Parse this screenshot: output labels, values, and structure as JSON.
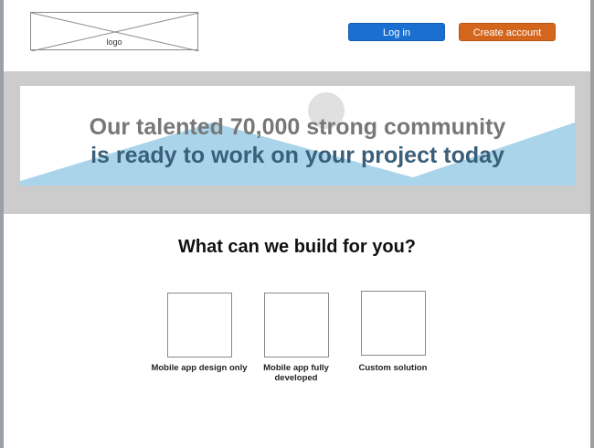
{
  "header": {
    "logo_label": "logo",
    "login_label": "Log in",
    "create_account_label": "Create account"
  },
  "hero": {
    "line1": "Our talented 70,000 strong community",
    "line2": "is ready to work on your project today"
  },
  "section": {
    "title": "What can we build for you?"
  },
  "options": [
    {
      "label": "Mobile app design only"
    },
    {
      "label": "Mobile app fully developed"
    },
    {
      "label": "Custom solution"
    }
  ],
  "colors": {
    "login": "#1a6fd0",
    "create_account": "#d4651c",
    "hero_band": "#cccccc",
    "hero_wave": "#a9d4ea"
  }
}
